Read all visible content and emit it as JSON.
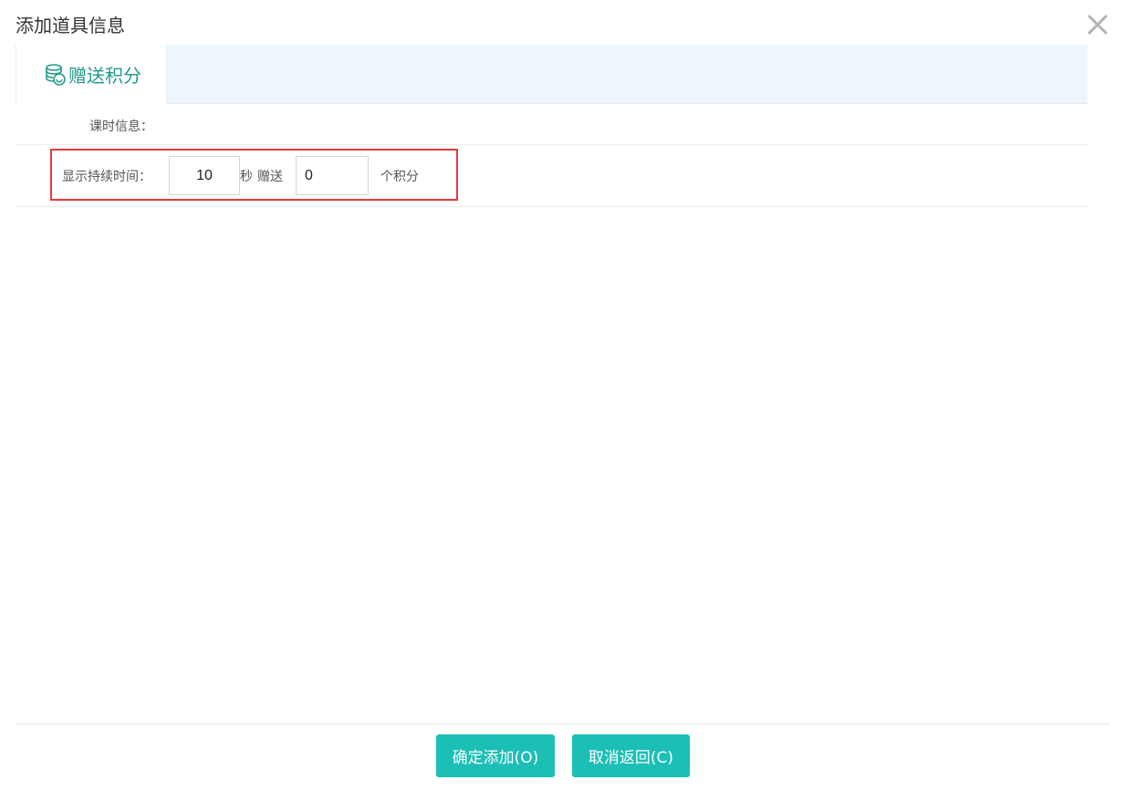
{
  "dialog": {
    "title": "添加道具信息"
  },
  "tabs": [
    {
      "label": "赠送积分",
      "icon": "coins-icon",
      "active": true
    }
  ],
  "form": {
    "course_info_label": "课时信息：",
    "duration_label": "显示持续时间：",
    "duration_value": "10",
    "seconds_unit": "秒",
    "gift_label": "赠送",
    "points_value": "0",
    "points_unit": "个积分"
  },
  "footer": {
    "confirm_label": "确定添加(O)",
    "cancel_label": "取消返回(C)"
  },
  "colors": {
    "accent": "#1bbfb5",
    "tab_text": "#22998a",
    "highlight_border": "#e53a3a"
  }
}
